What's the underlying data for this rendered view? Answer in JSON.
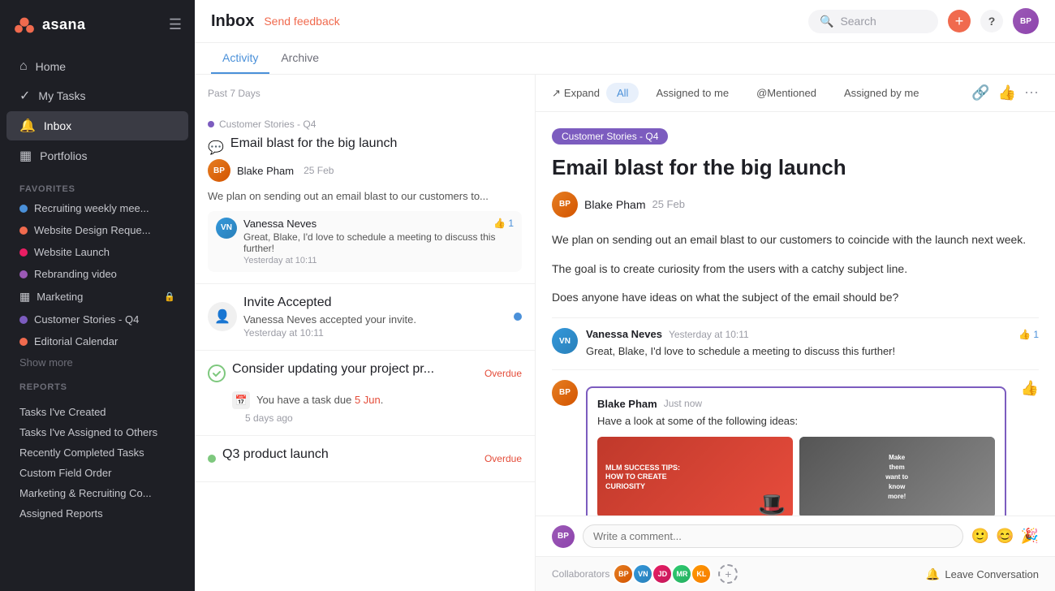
{
  "app": {
    "logo_text": "asana"
  },
  "sidebar": {
    "nav_items": [
      {
        "id": "home",
        "label": "Home",
        "icon": "🏠"
      },
      {
        "id": "my-tasks",
        "label": "My Tasks",
        "icon": "✓"
      },
      {
        "id": "inbox",
        "label": "Inbox",
        "icon": "🔔",
        "active": true
      },
      {
        "id": "portfolios",
        "label": "Portfolios",
        "icon": "📊"
      }
    ],
    "favorites_section": "Favorites",
    "favorites": [
      {
        "id": "recruiting",
        "label": "Recruiting weekly mee...",
        "color": "#4a90d9"
      },
      {
        "id": "website-design",
        "label": "Website Design Reque...",
        "color": "#f06a4e"
      },
      {
        "id": "website-launch",
        "label": "Website Launch",
        "color": "#e91e63"
      },
      {
        "id": "rebranding",
        "label": "Rebranding video",
        "color": "#9b59b6"
      },
      {
        "id": "marketing",
        "label": "Marketing",
        "icon": "📊",
        "lock": true
      },
      {
        "id": "customer-stories",
        "label": "Customer Stories - Q4",
        "color": "#7c5cbf"
      },
      {
        "id": "editorial",
        "label": "Editorial Calendar",
        "color": "#f06a4e"
      }
    ],
    "show_more": "Show more",
    "reports_section": "Reports",
    "reports": [
      {
        "id": "tasks-created",
        "label": "Tasks I've Created"
      },
      {
        "id": "tasks-assigned",
        "label": "Tasks I've Assigned to Others"
      },
      {
        "id": "recently-completed",
        "label": "Recently Completed Tasks"
      },
      {
        "id": "custom-field",
        "label": "Custom Field Order"
      },
      {
        "id": "marketing-recruiting",
        "label": "Marketing & Recruiting Co..."
      },
      {
        "id": "assigned-reports",
        "label": "Assigned Reports"
      }
    ]
  },
  "topbar": {
    "title": "Inbox",
    "feedback_label": "Send feedback",
    "search_placeholder": "Search",
    "add_btn_label": "+",
    "help_btn_label": "?"
  },
  "tabs": [
    {
      "id": "activity",
      "label": "Activity",
      "active": true
    },
    {
      "id": "archive",
      "label": "Archive"
    }
  ],
  "activity_panel": {
    "period_label": "Past 7 Days",
    "items": [
      {
        "id": "email-blast",
        "project": "Customer Stories - Q4",
        "project_color": "#7c5cbf",
        "title": "Email blast for the big launch",
        "author": "Blake Pham",
        "date": "25 Feb",
        "body": "We plan on sending out an email blast to our customers to...",
        "reply_author": "Vanessa Neves",
        "reply_text": "Great, Blake, I'd love to schedule a meeting to discuss this further!",
        "reply_time": "Yesterday at 10:11",
        "reply_likes": "1"
      },
      {
        "id": "invite-accepted",
        "title": "Invite Accepted",
        "sub": "Vanessa Neves accepted your invite.",
        "time": "Yesterday at 10:11",
        "unread": true
      },
      {
        "id": "update-project",
        "title": "Consider updating your project pr...",
        "overdue": "Overdue",
        "task_text": "You have a task due",
        "due_date": "5 Jun",
        "time_ago": "5 days ago"
      },
      {
        "id": "q3-launch",
        "title": "Q3 product launch",
        "overdue": "Overdue"
      }
    ]
  },
  "detail": {
    "project_tag": "Customer Stories - Q4",
    "project_tag_color": "#7c5cbf",
    "title": "Email blast for the big launch",
    "author": "Blake Pham",
    "date": "25 Feb",
    "body_lines": [
      "We plan on sending out an email blast to our customers to coincide with the launch next week.",
      "The goal is to create curiosity from the users with a catchy subject line.",
      "Does anyone have ideas on what the subject of the email should be?"
    ],
    "filters": [
      {
        "id": "all",
        "label": "All",
        "active": true
      },
      {
        "id": "assigned-to-me",
        "label": "Assigned to me"
      },
      {
        "id": "mentioned",
        "label": "@Mentioned"
      },
      {
        "id": "assigned-by-me",
        "label": "Assigned by me"
      }
    ],
    "expand_label": "Expand",
    "comments": [
      {
        "id": "vanessa-comment",
        "author": "Vanessa Neves",
        "time": "Yesterday at 10:11",
        "text": "Great, Blake, I'd love to schedule a meeting to discuss this further!",
        "likes": "1"
      },
      {
        "id": "blake-comment",
        "author": "Blake Pham",
        "time": "Just now",
        "text": "Have a look at some of the following ideas:",
        "has_images": true,
        "image1_title": "MLM SUCCESS TIPS:",
        "image1_subtitle": "HOW TO CREATE CURIOSITY",
        "image2_text": "Make them want to know more!"
      }
    ],
    "comment_placeholder": "Write a comment...",
    "collaborators_label": "Collaborators",
    "leave_conversation": "Leave Conversation"
  }
}
